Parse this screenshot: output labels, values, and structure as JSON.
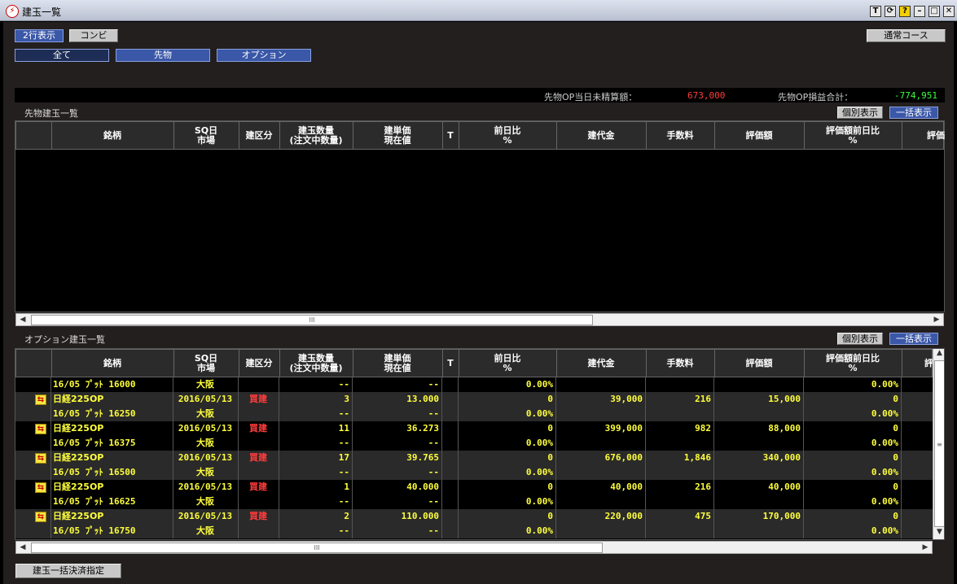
{
  "window": {
    "title": "建玉一覧",
    "buttons": [
      "T",
      "⟳",
      "?",
      "–",
      "□",
      "✕"
    ]
  },
  "toolbar": {
    "view_2line": "2行表示",
    "view_combi": "コンビ",
    "course": "通常コース",
    "filter_all": "全て",
    "filter_futures": "先物",
    "filter_options": "オプション"
  },
  "info": {
    "unsettled_label": "先物OP当日未精算額：",
    "unsettled_value": "673,000",
    "pl_label": "先物OP損益合計：",
    "pl_value": "-774,951"
  },
  "futures": {
    "title": "先物建玉一覧",
    "btn_individual": "個別表示",
    "btn_bulk": "一括表示"
  },
  "options": {
    "title": "オプション建玉一覧",
    "btn_individual": "個別表示",
    "btn_bulk": "一括表示"
  },
  "columns": {
    "meigara": "銘柄",
    "sq": [
      "SQ日",
      "市場"
    ],
    "kubun": "建区分",
    "qty": [
      "建玉数量",
      "(注文中数量)"
    ],
    "price": [
      "建単価",
      "現在値"
    ],
    "t": "T",
    "prevday": [
      "前日比",
      "%"
    ],
    "daikin": "建代金",
    "fee": "手数料",
    "hyouka": "評価額",
    "hyouka_prev": [
      "評価額前日比",
      "%"
    ],
    "last_futures": "評価",
    "last_options": "評"
  },
  "scroll_grip": "III",
  "option_rows": [
    {
      "partial": true,
      "l2": [
        "16/05 ﾌﾟｯﾄ 16000",
        "大阪",
        "",
        "--",
        "--",
        "",
        "0.00%",
        "",
        "",
        "",
        "0.00%"
      ]
    },
    {
      "l1": [
        "日経225OP",
        "2016/05/13",
        "買建",
        "3",
        "13.000",
        "",
        "0",
        "39,000",
        "216",
        "15,000",
        "0"
      ],
      "l2": [
        "16/05 ﾌﾟｯﾄ 16250",
        "大阪",
        "",
        "--",
        "--",
        "",
        "0.00%",
        "",
        "",
        "",
        "0.00%"
      ]
    },
    {
      "l1": [
        "日経225OP",
        "2016/05/13",
        "買建",
        "11",
        "36.273",
        "",
        "0",
        "399,000",
        "982",
        "88,000",
        "0"
      ],
      "l2": [
        "16/05 ﾌﾟｯﾄ 16375",
        "大阪",
        "",
        "--",
        "--",
        "",
        "0.00%",
        "",
        "",
        "",
        "0.00%"
      ]
    },
    {
      "l1": [
        "日経225OP",
        "2016/05/13",
        "買建",
        "17",
        "39.765",
        "",
        "0",
        "676,000",
        "1,846",
        "340,000",
        "0"
      ],
      "l2": [
        "16/05 ﾌﾟｯﾄ 16500",
        "大阪",
        "",
        "--",
        "--",
        "",
        "0.00%",
        "",
        "",
        "",
        "0.00%"
      ]
    },
    {
      "l1": [
        "日経225OP",
        "2016/05/13",
        "買建",
        "1",
        "40.000",
        "",
        "0",
        "40,000",
        "216",
        "40,000",
        "0"
      ],
      "l2": [
        "16/05 ﾌﾟｯﾄ 16625",
        "大阪",
        "",
        "--",
        "--",
        "",
        "0.00%",
        "",
        "",
        "",
        "0.00%"
      ]
    },
    {
      "l1": [
        "日経225OP",
        "2016/05/13",
        "買建",
        "2",
        "110.000",
        "",
        "0",
        "220,000",
        "475",
        "170,000",
        "0"
      ],
      "l2": [
        "16/05 ﾌﾟｯﾄ 16750",
        "大阪",
        "",
        "--",
        "--",
        "",
        "0.00%",
        "",
        "",
        "",
        "0.00%"
      ]
    }
  ],
  "footer": {
    "bulk_settle": "建玉一括決済指定"
  },
  "colors": {
    "yellow_text": "#ffff3c",
    "red_text": "#ff3c3c",
    "blue_button": "#3a57a8"
  }
}
